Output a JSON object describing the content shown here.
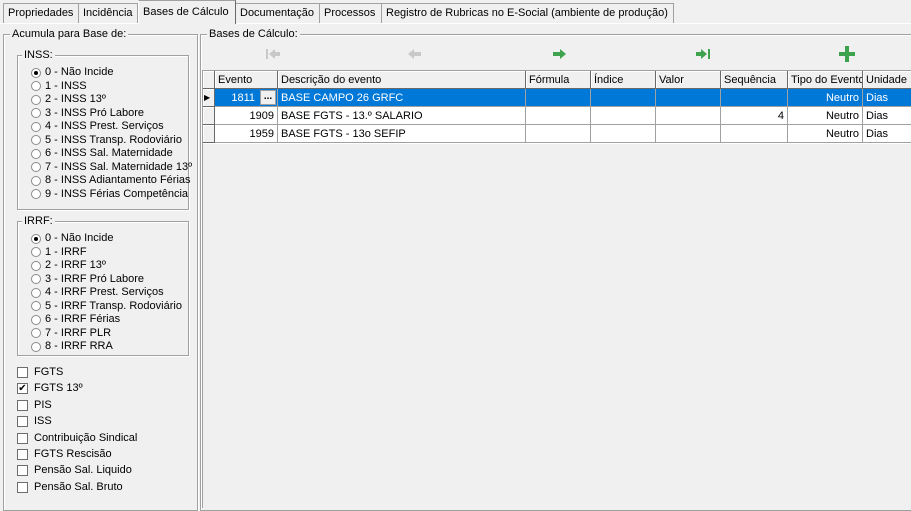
{
  "tabs": [
    {
      "label": "Propriedades"
    },
    {
      "label": "Incidência"
    },
    {
      "label": "Bases de Cálculo"
    },
    {
      "label": "Documentação"
    },
    {
      "label": "Processos"
    },
    {
      "label": "Registro de Rubricas no E-Social (ambiente de produção)"
    }
  ],
  "left": {
    "title": "Acumula para Base de:",
    "inss": {
      "title": "INSS:",
      "options": [
        "0 - Não Incide",
        "1 - INSS",
        "2 - INSS 13º",
        "3 - INSS Pró Labore",
        "4 - INSS Prest. Serviços",
        "5 - INSS Transp. Rodoviário",
        "6 - INSS Sal. Maternidade",
        "7 - INSS Sal. Maternidade 13º",
        "8 - INSS Adiantamento Férias",
        "9 - INSS Férias Competência"
      ]
    },
    "irrf": {
      "title": "IRRF:",
      "options": [
        "0 - Não Incide",
        "1 - IRRF",
        "2 - IRRF 13º",
        "3 - IRRF Pró Labore",
        "4 - IRRF Prest. Serviços",
        "5 - IRRF Transp. Rodoviário",
        "6 - IRRF Férias",
        "7 - IRRF PLR",
        "8 - IRRF RRA"
      ]
    },
    "checks": [
      {
        "label": "FGTS",
        "checked": false
      },
      {
        "label": "FGTS 13º",
        "checked": true
      },
      {
        "label": "PIS",
        "checked": false
      },
      {
        "label": "ISS",
        "checked": false
      },
      {
        "label": "Contribuição Sindical",
        "checked": false
      },
      {
        "label": "FGTS Rescisão",
        "checked": false
      },
      {
        "label": "Pensão Sal. Liquido",
        "checked": false
      },
      {
        "label": "Pensão Sal. Bruto",
        "checked": false
      }
    ]
  },
  "right": {
    "title": "Bases de Cálculo:",
    "columns": [
      "Evento",
      "Descrição do evento",
      "Fórmula",
      "Índice",
      "Valor",
      "Sequência",
      "Tipo do Evento",
      "Unidade"
    ],
    "rows": [
      {
        "evento": "1811",
        "descricao": "BASE CAMPO 26 GRFC",
        "formula": "",
        "indice": "",
        "valor": "",
        "sequencia": "",
        "tipo": "Neutro",
        "unidade": "Dias"
      },
      {
        "evento": "1909",
        "descricao": "BASE FGTS - 13.º SALARIO",
        "formula": "",
        "indice": "",
        "valor": "",
        "sequencia": "4",
        "tipo": "Neutro",
        "unidade": "Dias"
      },
      {
        "evento": "1959",
        "descricao": "BASE FGTS - 13o SEFIP",
        "formula": "",
        "indice": "",
        "valor": "",
        "sequencia": "",
        "tipo": "Neutro",
        "unidade": "Dias"
      }
    ],
    "ellipsis": "..."
  }
}
